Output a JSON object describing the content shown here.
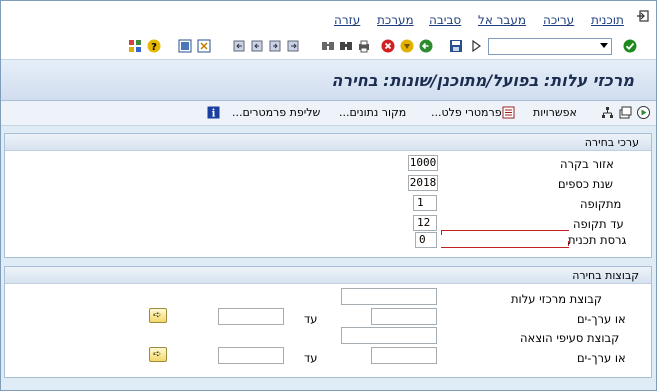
{
  "menu": {
    "items": [
      "תוכנית",
      "עריכה",
      "מעבר אל",
      "סביבה",
      "מערכת",
      "עזרה"
    ]
  },
  "toolbar": {
    "command_field_value": ""
  },
  "page": {
    "title": "מרכזי עלות: בפועל/מתוכנן/שונות: בחירה"
  },
  "app_toolbar": {
    "options_label": "אפשרויות",
    "output_params_label": "פרמטרי פלט...",
    "data_source_label": "מקור נתונים...",
    "fetch_params_label": "שליפת פרמטרים..."
  },
  "selection_values": {
    "title": "ערכי בחירה",
    "controlling_area_label": "אזור בקרה",
    "controlling_area_value": "1000",
    "fiscal_year_label": "שנת כספים",
    "fiscal_year_value": "2018",
    "from_period_label": "מתקופה",
    "from_period_value": "1",
    "to_period_label": "עד תקופה",
    "to_period_value": "12",
    "plan_version_label": "גרסת תכנית",
    "plan_version_value": "0"
  },
  "selection_groups": {
    "title": "קבוצות בחירה",
    "cost_center_group_label": "קבוצת מרכזי עלות",
    "or_values_label_1": "או ערך-ים",
    "to_label_1": "עד",
    "cost_element_group_label": "קבוצת סעיפי הוצאה",
    "or_values_label_2": "או ערך-ים",
    "to_label_2": "עד"
  }
}
